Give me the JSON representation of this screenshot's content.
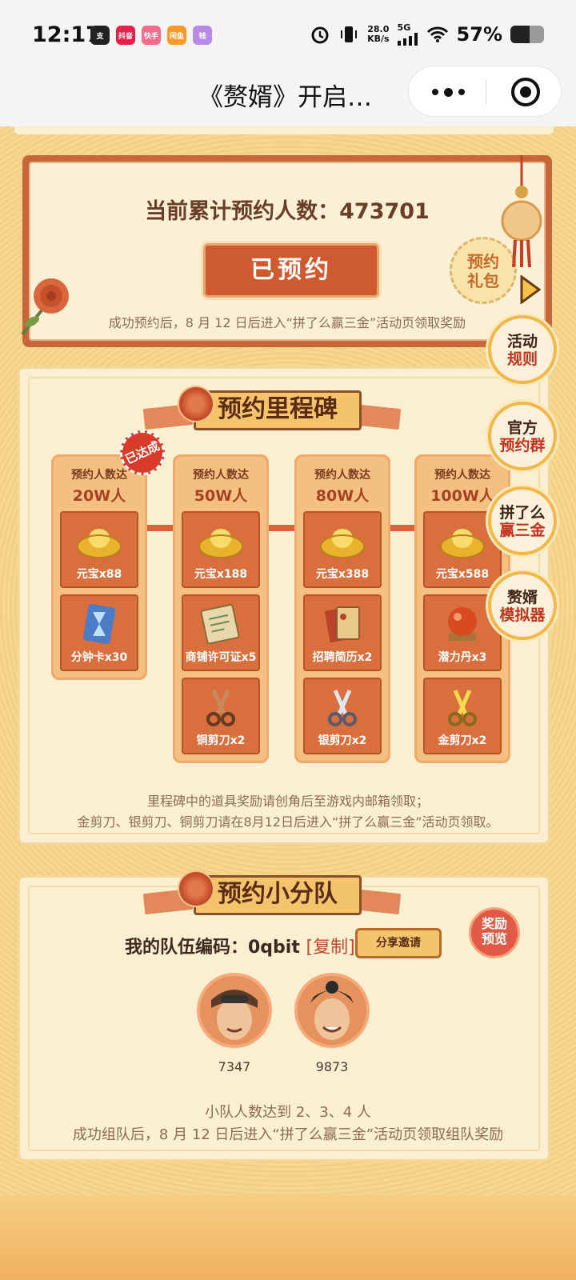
{
  "status_bar": {
    "time": "12:17",
    "apps": [
      "支",
      "抖音",
      "快手",
      "闲鱼",
      "钱"
    ],
    "net_speed_value": "28.0",
    "net_speed_unit": "KB/s",
    "network": "5G",
    "battery": "57%",
    "battery_level": 0.57
  },
  "title_bar": {
    "title": "《赘婿》开启…"
  },
  "reserve_card": {
    "count_label": "当前累计预约人数：473701",
    "button_label": "已预约",
    "note": "成功预约后，8 月 12 日后进入“拼了么赢三金”活动页领取奖励",
    "gift_badge": [
      "预约",
      "礼包"
    ]
  },
  "side_buttons": [
    {
      "l1": "活动",
      "l2": "规则"
    },
    {
      "l1": "官方",
      "l2": "预约群"
    },
    {
      "l1": "拼了么",
      "l2": "赢三金"
    },
    {
      "l1": "赘婿",
      "l2": "模拟器"
    }
  ],
  "milestone": {
    "title": "预约里程碑",
    "done_badge": "已达成",
    "columns": [
      {
        "head1": "预约人数达",
        "head2": "20W人",
        "items": [
          {
            "label": "元宝x88",
            "icon": "gold-ingot-icon"
          },
          {
            "label": "分钟卡x30",
            "icon": "hourglass-card-icon"
          }
        ]
      },
      {
        "head1": "预约人数达",
        "head2": "50W人",
        "items": [
          {
            "label": "元宝x188",
            "icon": "gold-ingot-icon"
          },
          {
            "label": "商铺许可证x5",
            "icon": "shop-license-icon"
          },
          {
            "label": "铜剪刀x2",
            "icon": "copper-scissors-icon"
          }
        ]
      },
      {
        "head1": "预约人数达",
        "head2": "80W人",
        "items": [
          {
            "label": "元宝x388",
            "icon": "gold-ingot-icon"
          },
          {
            "label": "招聘简历x2",
            "icon": "resume-book-icon"
          },
          {
            "label": "银剪刀x2",
            "icon": "silver-scissors-icon"
          }
        ]
      },
      {
        "head1": "预约人数达",
        "head2": "100W人",
        "items": [
          {
            "label": "元宝x588",
            "icon": "gold-ingot-icon"
          },
          {
            "label": "潜力丹x3",
            "icon": "potential-pill-icon"
          },
          {
            "label": "金剪刀x2",
            "icon": "gold-scissors-icon"
          }
        ]
      }
    ],
    "note1": "里程碑中的道具奖励请创角后至游戏内邮箱领取；",
    "note2": "金剪刀、银剪刀、铜剪刀请在8月12日后进入“拼了么赢三金”活动页领取。"
  },
  "team": {
    "title": "预约小分队",
    "code_label": "我的队伍编码：0qbit",
    "copy_label": "[复制]",
    "share_label": "分享邀请",
    "reward_preview": [
      "奖励",
      "预览"
    ],
    "members": [
      {
        "name": "7347"
      },
      {
        "name": "9873"
      }
    ],
    "note1": "小队人数达到 2、3、4 人",
    "note2": "成功组队后，8 月 12 日后进入“拼了么赢三金”活动页领取组队奖励"
  },
  "colors": {
    "accent": "#cd5a30",
    "panel": "#fbefd2",
    "gold": "#f4c46c"
  }
}
